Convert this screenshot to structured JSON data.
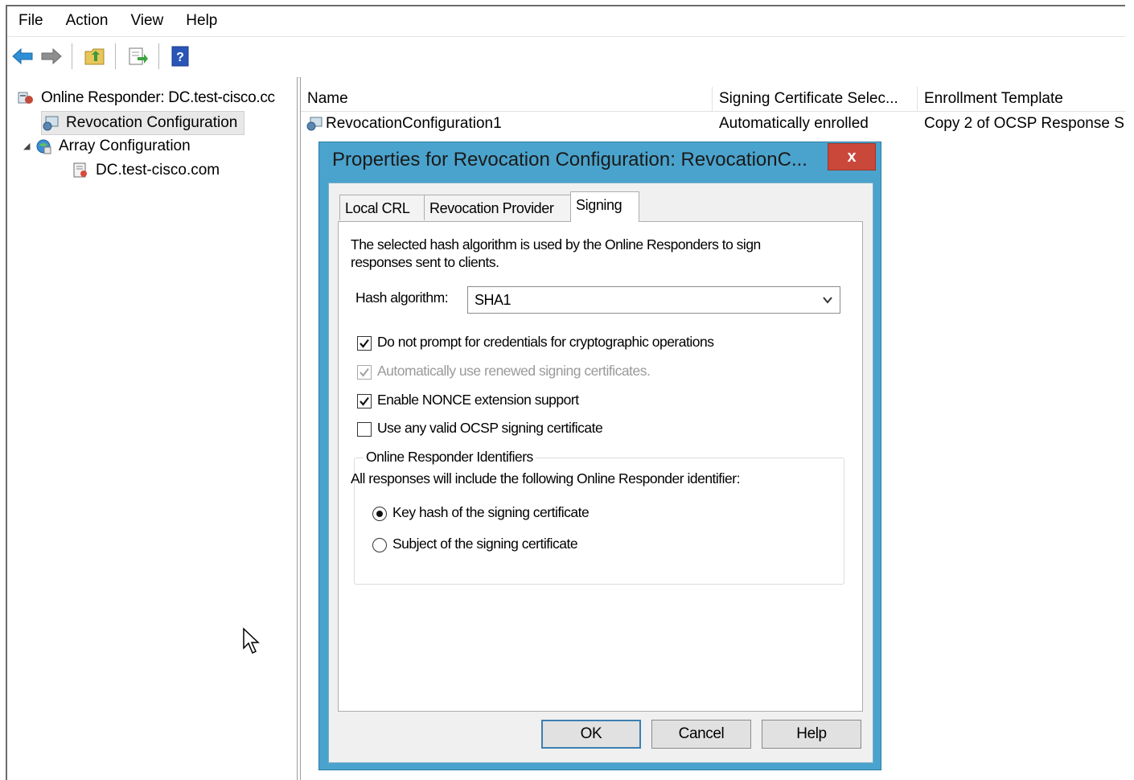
{
  "menu": {
    "items": [
      "File",
      "Action",
      "View",
      "Help"
    ]
  },
  "toolbar": {
    "icons": [
      "back-arrow-icon",
      "forward-arrow-icon",
      "up-folder-icon",
      "export-list-icon",
      "help-icon"
    ]
  },
  "tree": {
    "root": "Online Responder: DC.test-cisco.cc",
    "revocation": "Revocation Configuration",
    "array": "Array Configuration",
    "host": "DC.test-cisco.com"
  },
  "list": {
    "columns": [
      "Name",
      "Signing Certificate Selec...",
      "Enrollment Template"
    ],
    "rows": [
      {
        "name": "RevocationConfiguration1",
        "signing": "Automatically enrolled",
        "template": "Copy 2 of OCSP Response S"
      }
    ]
  },
  "dialog": {
    "title": "Properties for Revocation Configuration: RevocationC...",
    "close_label": "x",
    "tabs": [
      "Local CRL",
      "Revocation Provider",
      "Signing"
    ],
    "active_tab": "Signing",
    "description_line1": "The selected hash algorithm is used by the Online Responders to sign",
    "description_line2": "responses sent to clients.",
    "hash_label": "Hash algorithm:",
    "hash_value": "SHA1",
    "checkboxes": [
      {
        "label": "Do not prompt for credentials for cryptographic operations",
        "checked": true,
        "enabled": true
      },
      {
        "label": "Automatically use renewed signing certificates.",
        "checked": true,
        "enabled": false
      },
      {
        "label": "Enable NONCE extension support",
        "checked": true,
        "enabled": true
      },
      {
        "label": "Use any valid OCSP signing certificate",
        "checked": false,
        "enabled": true
      }
    ],
    "group": {
      "title": "Online Responder Identifiers",
      "description": "All responses will include the following Online Responder identifier:",
      "options": [
        {
          "label": "Key hash of the signing certificate",
          "selected": true
        },
        {
          "label": "Subject of the signing certificate",
          "selected": false
        }
      ]
    },
    "buttons": {
      "ok": "OK",
      "cancel": "Cancel",
      "help": "Help"
    }
  }
}
